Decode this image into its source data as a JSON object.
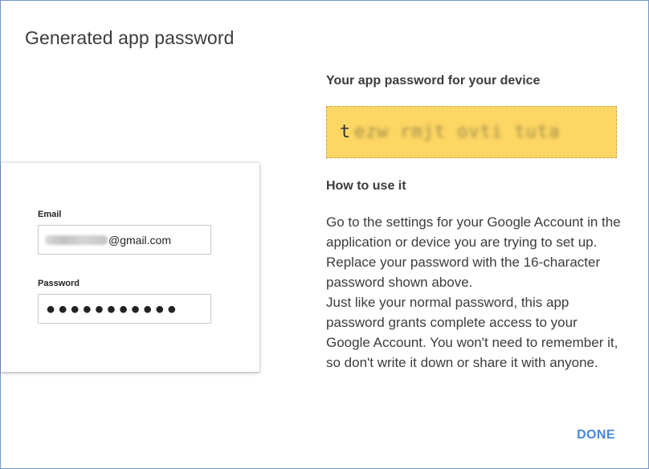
{
  "dialog": {
    "title": "Generated app password"
  },
  "illustration": {
    "email_label": "Email",
    "email_suffix": "@gmail.com",
    "password_label": "Password",
    "password_dots": "●●●●●●●●●●●"
  },
  "password_section": {
    "heading": "Your app password for your device",
    "first_char": "t",
    "obscured": "ezw rmjt ovti tuta"
  },
  "how_to": {
    "heading": "How to use it",
    "paragraph_1": "Go to the settings for your Google Account in the application or device you are trying to set up. Replace your password with the 16-character password shown above.",
    "paragraph_2": "Just like your normal password, this app password grants complete access to your Google Account. You won't need to remember it, so don't write it down or share it with anyone."
  },
  "actions": {
    "done_label": "DONE"
  },
  "colors": {
    "password_highlight": "#fdd663",
    "accent": "#4a86d8",
    "dialog_border": "#6f97c8"
  }
}
